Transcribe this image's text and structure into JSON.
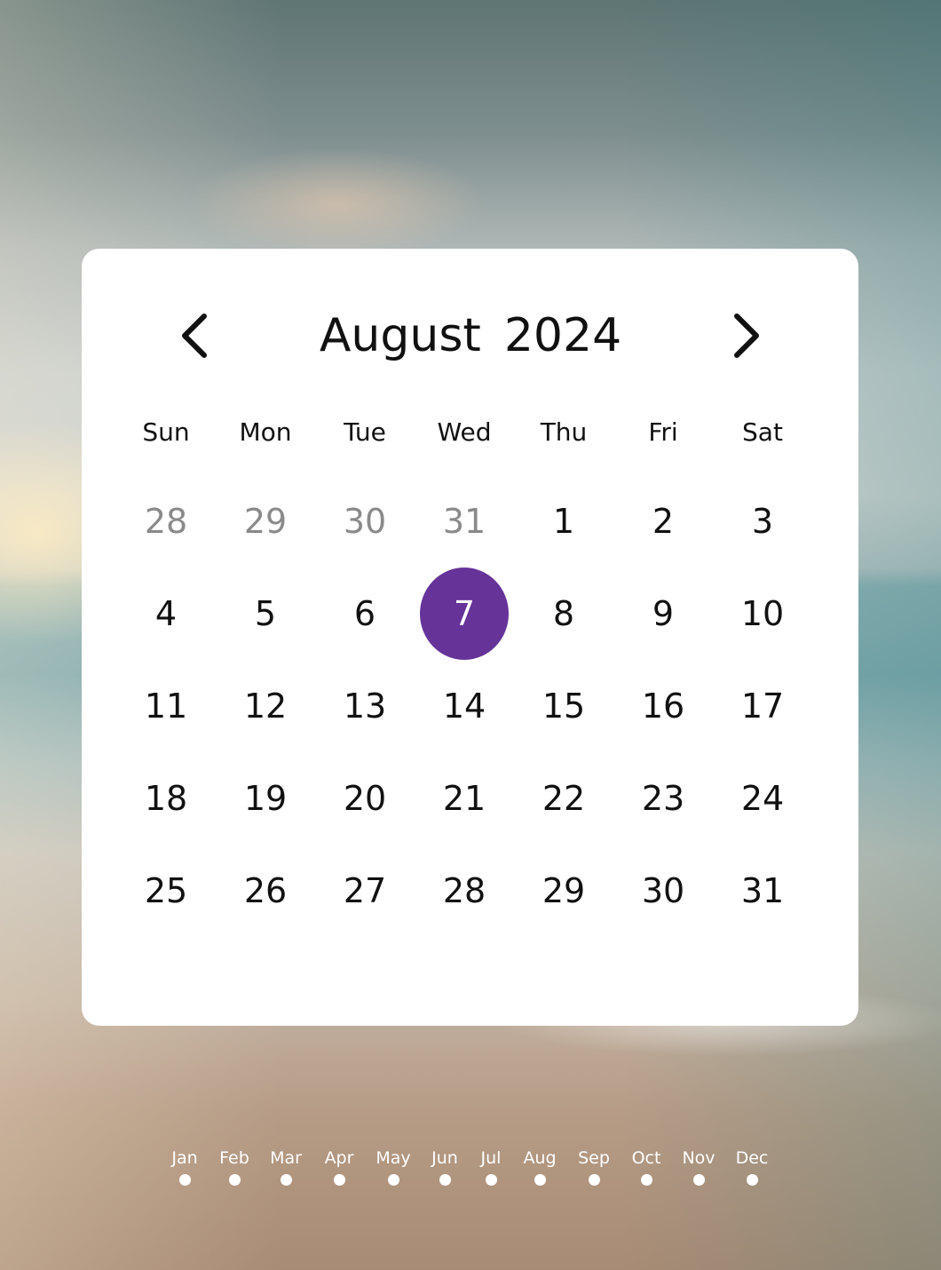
{
  "calendar": {
    "month": "August",
    "year": "2024",
    "weekdays": [
      "Sun",
      "Mon",
      "Tue",
      "Wed",
      "Thu",
      "Fri",
      "Sat"
    ],
    "weeks": [
      [
        "28",
        "29",
        "30",
        "31",
        "1",
        "2",
        "3"
      ],
      [
        "4",
        "5",
        "6",
        "7",
        "8",
        "9",
        "10"
      ],
      [
        "11",
        "12",
        "13",
        "14",
        "15",
        "16",
        "17"
      ],
      [
        "18",
        "19",
        "20",
        "21",
        "22",
        "23",
        "24"
      ],
      [
        "25",
        "26",
        "27",
        "28",
        "29",
        "30",
        "31"
      ]
    ],
    "outside_month_days": 4,
    "selected_day": "7",
    "selected_color": "#663399"
  },
  "icons": {
    "prev": "chevron-left-icon",
    "next": "chevron-right-icon"
  },
  "month_nav": [
    "Jan",
    "Feb",
    "Mar",
    "Apr",
    "May",
    "Jun",
    "Jul",
    "Aug",
    "Sep",
    "Oct",
    "Nov",
    "Dec"
  ]
}
